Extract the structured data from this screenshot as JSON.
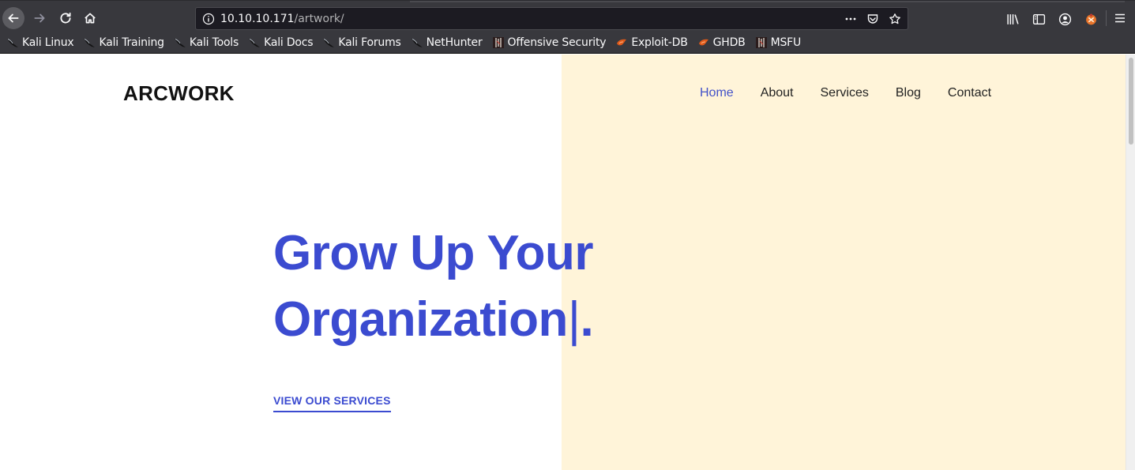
{
  "browser": {
    "url_host": "10.10.10.171",
    "url_path": "/artwork/",
    "bookmarks": [
      {
        "label": "Kali Linux",
        "icon": "kali-dragon-icon"
      },
      {
        "label": "Kali Training",
        "icon": "kali-dragon-icon"
      },
      {
        "label": "Kali Tools",
        "icon": "kali-dragon-icon"
      },
      {
        "label": "Kali Docs",
        "icon": "kali-dragon-icon"
      },
      {
        "label": "Kali Forums",
        "icon": "kali-dragon-icon"
      },
      {
        "label": "NetHunter",
        "icon": "kali-dragon-icon"
      },
      {
        "label": "Offensive Security",
        "icon": "offsec-icon"
      },
      {
        "label": "Exploit-DB",
        "icon": "exploit-db-icon"
      },
      {
        "label": "GHDB",
        "icon": "exploit-db-icon"
      },
      {
        "label": "MSFU",
        "icon": "offsec-icon"
      }
    ]
  },
  "site": {
    "brand": "ARCWORK",
    "nav": [
      {
        "label": "Home",
        "active": true
      },
      {
        "label": "About",
        "active": false
      },
      {
        "label": "Services",
        "active": false
      },
      {
        "label": "Blog",
        "active": false
      },
      {
        "label": "Contact",
        "active": false
      }
    ],
    "hero": {
      "line1": "Grow Up Your",
      "line2": "Organization",
      "cursor": "|",
      "period": ".",
      "cta_label": "VIEW OUR SERVICES"
    }
  },
  "colors": {
    "accent": "#3b4bd0",
    "panel": "#fff4d9",
    "chrome": "#38383d"
  }
}
